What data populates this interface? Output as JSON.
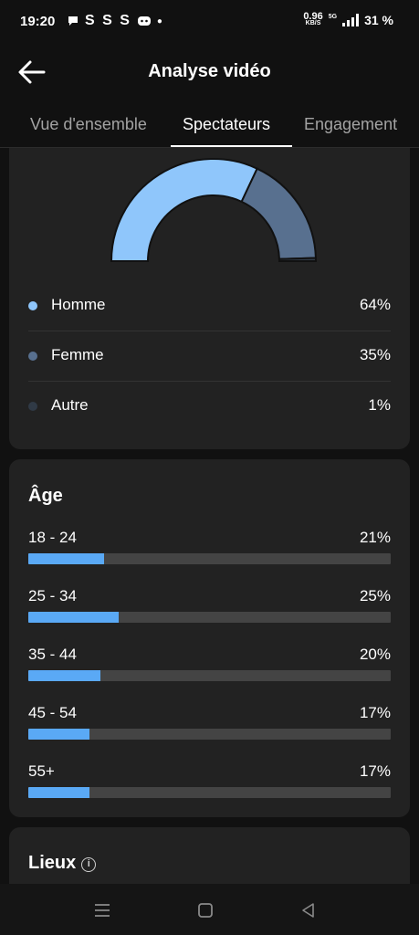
{
  "status_bar": {
    "time": "19:20",
    "notif_icons": "S S S",
    "net_speed": "0.96",
    "net_unit": "KB/S",
    "network": "5G",
    "battery": "31 %"
  },
  "header": {
    "title": "Analyse vidéo"
  },
  "tabs": [
    {
      "label": "Vue d'ensemble",
      "active": false
    },
    {
      "label": "Spectateurs",
      "active": true
    },
    {
      "label": "Engagement",
      "active": false
    }
  ],
  "gender": {
    "items": [
      {
        "label": "Homme",
        "value": "64%",
        "color": "#8fc6fb"
      },
      {
        "label": "Femme",
        "value": "35%",
        "color": "#58708f"
      },
      {
        "label": "Autre",
        "value": "1%",
        "color": "#303a46"
      }
    ]
  },
  "age": {
    "title": "Âge",
    "rows": [
      {
        "label": "18 - 24",
        "value": "21%",
        "fraction": 0.21
      },
      {
        "label": "25 - 34",
        "value": "25%",
        "fraction": 0.25
      },
      {
        "label": "35 - 44",
        "value": "20%",
        "fraction": 0.2
      },
      {
        "label": "45 - 54",
        "value": "17%",
        "fraction": 0.17
      },
      {
        "label": "55+",
        "value": "17%",
        "fraction": 0.17
      }
    ],
    "bar_color": "#5aa9f5"
  },
  "locations": {
    "title": "Lieux"
  },
  "chart_data": [
    {
      "type": "pie",
      "categories": [
        "Homme",
        "Femme",
        "Autre"
      ],
      "values": [
        64,
        35,
        1
      ]
    },
    {
      "type": "bar",
      "title": "Âge",
      "categories": [
        "18 - 24",
        "25 - 34",
        "35 - 44",
        "45 - 54",
        "55+"
      ],
      "values": [
        21,
        25,
        20,
        17,
        17
      ],
      "ylim": [
        0,
        100
      ]
    }
  ]
}
